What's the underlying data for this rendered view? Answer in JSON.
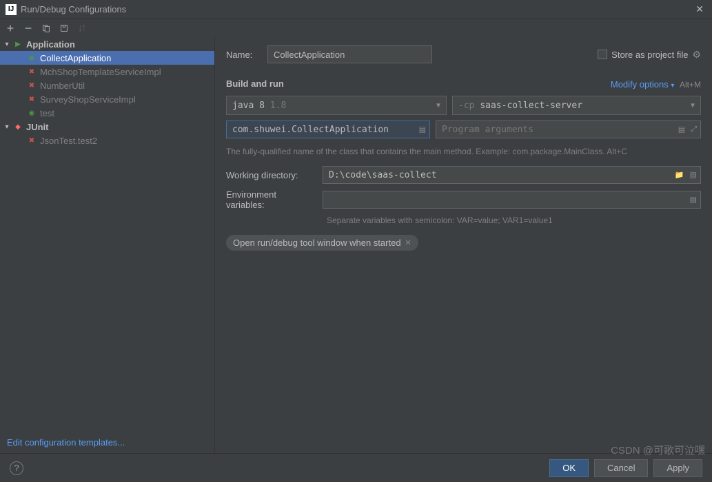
{
  "window": {
    "title": "Run/Debug Configurations"
  },
  "sidebar": {
    "application": {
      "label": "Application",
      "items": [
        {
          "name": "CollectApplication",
          "selected": true,
          "icon": "app"
        },
        {
          "name": "MchShopTemplateServiceImpl",
          "selected": false,
          "icon": "x"
        },
        {
          "name": "NumberUtil",
          "selected": false,
          "icon": "x"
        },
        {
          "name": "SurveyShopServiceImpl",
          "selected": false,
          "icon": "x"
        },
        {
          "name": "test",
          "selected": false,
          "icon": "app"
        }
      ]
    },
    "junit": {
      "label": "JUnit",
      "items": [
        {
          "name": "JsonTest.test2",
          "icon": "x"
        }
      ]
    },
    "edit_templates": "Edit configuration templates..."
  },
  "content": {
    "name_label": "Name:",
    "name_value": "CollectApplication",
    "store_label": "Store as project file",
    "build_section": "Build and run",
    "modify_label": "Modify options",
    "modify_shortcut": "Alt+M",
    "java_dropdown": {
      "text": "java 8",
      "version": "1.8"
    },
    "cp_prefix": "-cp",
    "cp_value": "saas-collect-server",
    "main_class": "com.shuwei.CollectApplication",
    "args_placeholder": "Program arguments",
    "main_hint": "The fully-qualified name of the class that contains the main method. Example: com.package.MainClass. Alt+C",
    "wd_label": "Working directory:",
    "wd_value": "D:\\code\\saas-collect",
    "env_label": "Environment variables:",
    "env_hint": "Separate variables with semicolon: VAR=value; VAR1=value1",
    "chip": "Open run/debug tool window when started"
  },
  "footer": {
    "ok": "OK",
    "cancel": "Cancel",
    "apply": "Apply"
  },
  "watermark": "CSDN @可歌可泣嘿"
}
